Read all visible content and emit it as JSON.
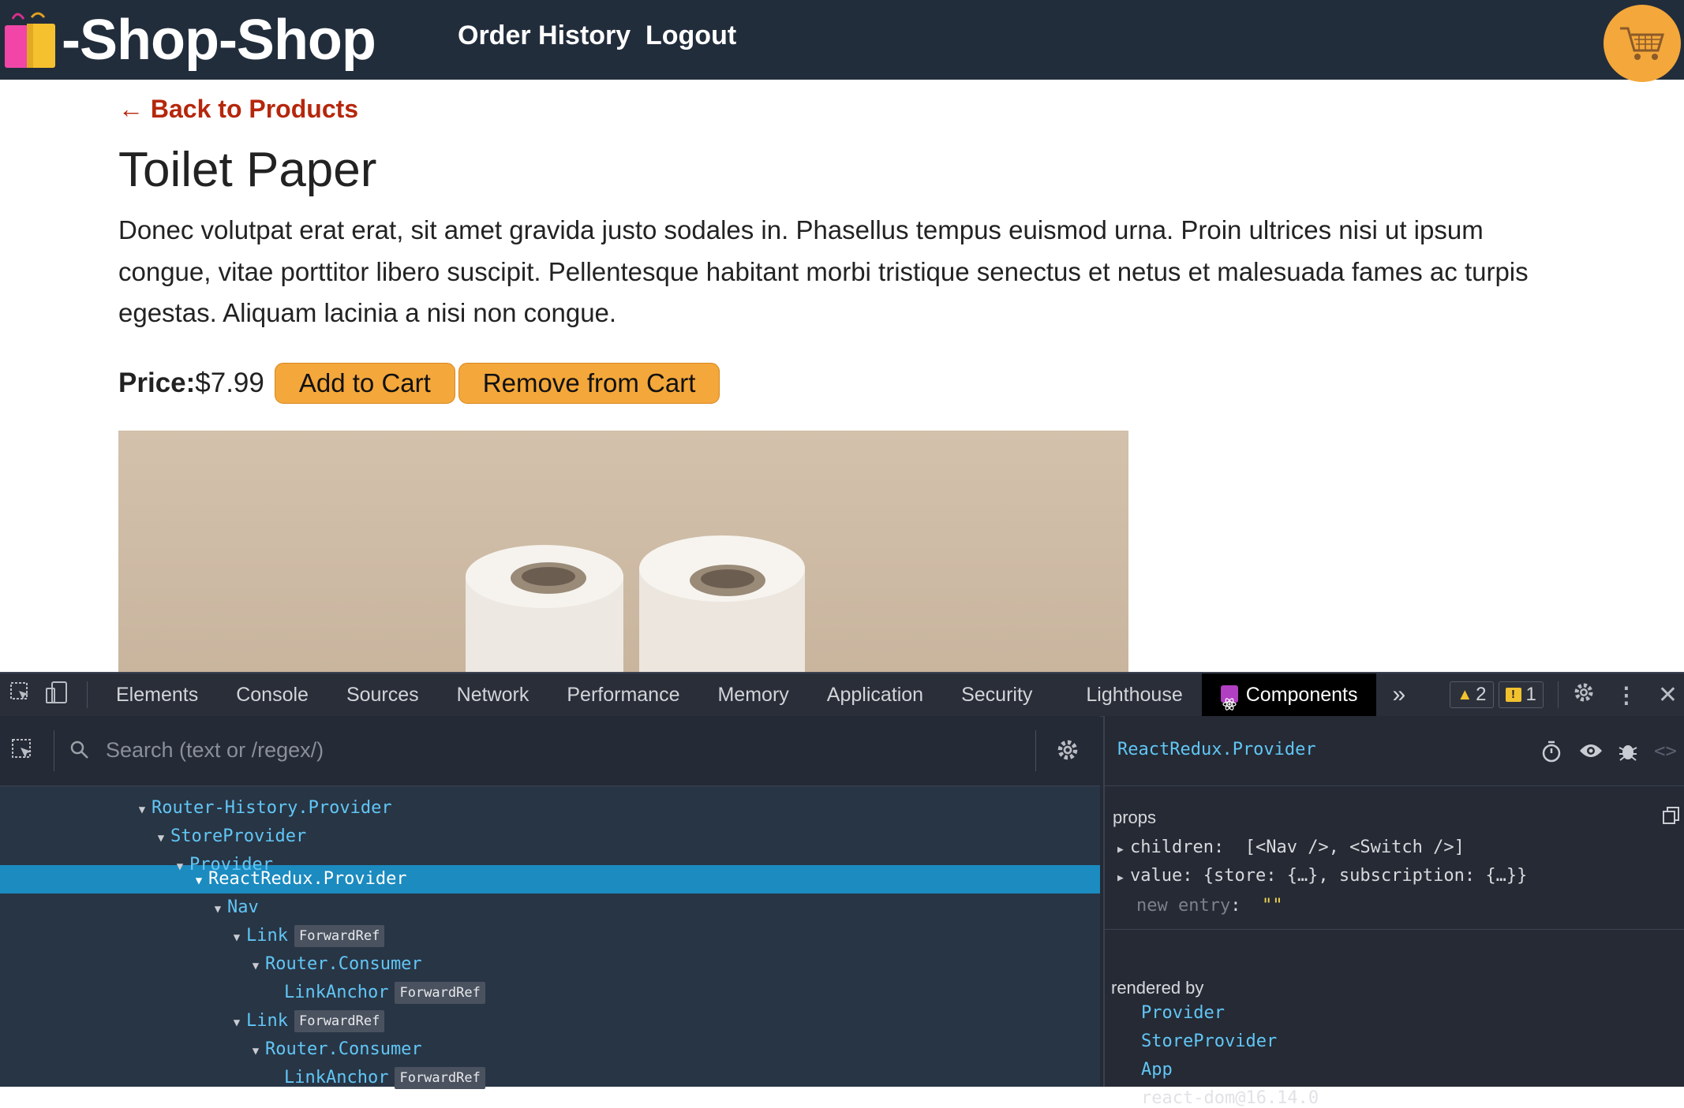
{
  "nav": {
    "brand": "-Shop-Shop",
    "links": [
      "Order History",
      "Logout"
    ],
    "cart_icon": "shopping-cart-icon",
    "accent": "#f4a73a"
  },
  "product": {
    "back_label": "← Back to Products",
    "title": "Toilet Paper",
    "description": "Donec volutpat erat erat, sit amet gravida justo sodales in. Phasellus tempus euismod urna. Proin ultrices nisi ut ipsum congue, vitae porttitor libero suscipit. Pellentesque habitant morbi tristique senectus et netus et malesuada fames ac turpis egestas. Aliquam lacinia a nisi non congue.",
    "price_label": "Price:",
    "price": "$7.99",
    "add_label": "Add to Cart",
    "remove_label": "Remove from Cart"
  },
  "devtools": {
    "tabs": [
      "Elements",
      "Console",
      "Sources",
      "Network",
      "Performance",
      "Memory",
      "Application",
      "Security",
      "Lighthouse",
      "Components"
    ],
    "active_tab": "Components",
    "more": "»",
    "warnings": "2",
    "issues": "1",
    "search_placeholder": "Search (text or /regex/)",
    "tree": [
      {
        "label": "Router-History.Provider",
        "badge": ""
      },
      {
        "label": "StoreProvider",
        "badge": ""
      },
      {
        "label": "Provider",
        "badge": ""
      },
      {
        "label": "ReactRedux.Provider",
        "badge": ""
      },
      {
        "label": "Nav",
        "badge": ""
      },
      {
        "label": "Link",
        "badge": "ForwardRef"
      },
      {
        "label": "Router.Consumer",
        "badge": ""
      },
      {
        "label": "LinkAnchor",
        "badge": "ForwardRef"
      },
      {
        "label": "Link",
        "badge": "ForwardRef"
      },
      {
        "label": "Router.Consumer",
        "badge": ""
      },
      {
        "label": "LinkAnchor",
        "badge": "ForwardRef"
      }
    ],
    "selected": {
      "name": "ReactRedux.Provider",
      "props_label": "props",
      "props": [
        {
          "key": "children:",
          "value": "[<Nav />, <Switch />]"
        },
        {
          "key": "value:",
          "value": "{store: {…}, subscription: {…}}"
        }
      ],
      "new_entry_label": "new entry",
      "new_entry_value": "\"\"",
      "rendered_by_label": "rendered by",
      "rendered_by": [
        "Provider",
        "StoreProvider",
        "App"
      ],
      "react_version": "react-dom@16.14.0"
    }
  }
}
